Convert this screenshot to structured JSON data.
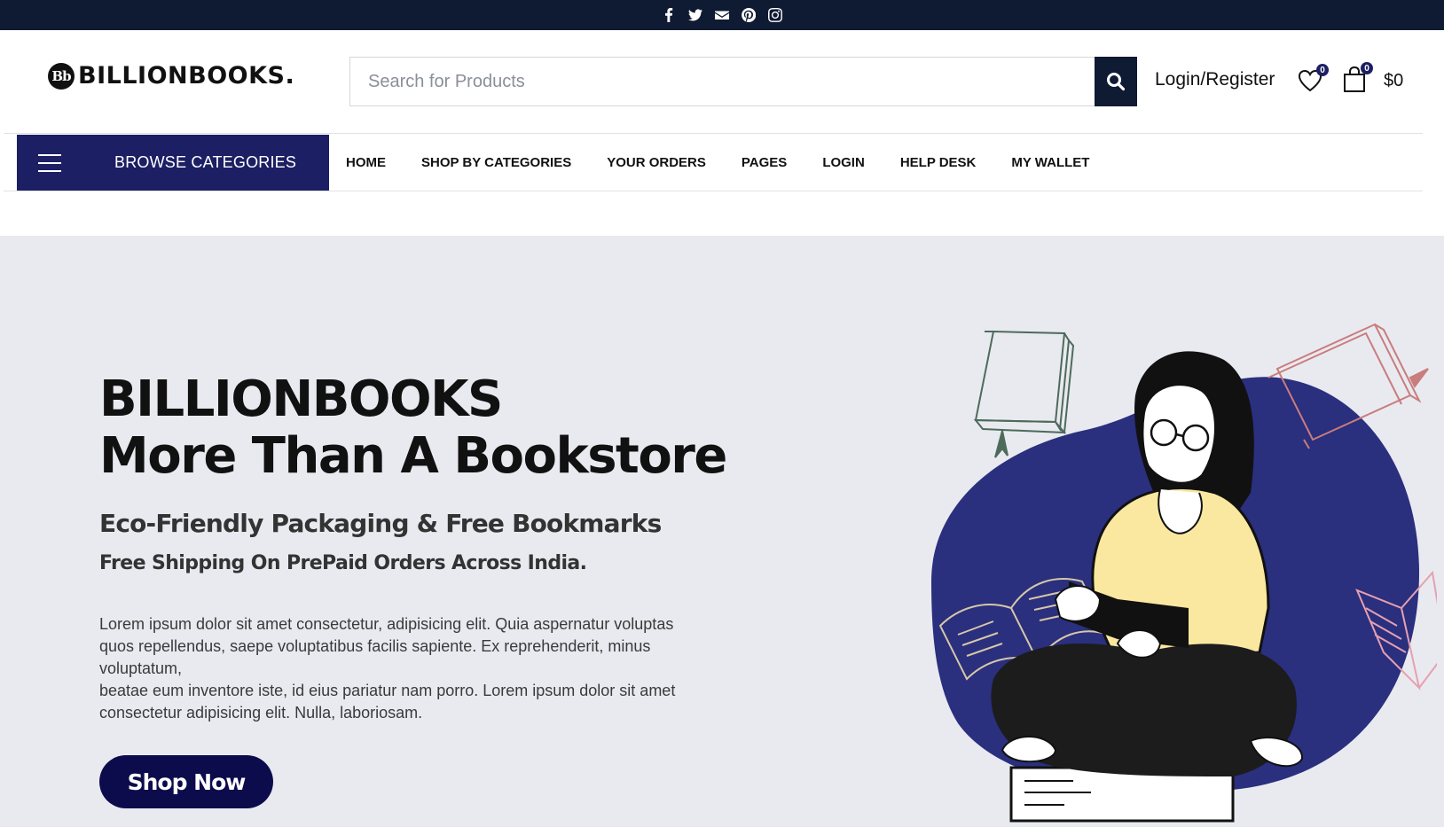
{
  "topbar": {
    "social": [
      {
        "icon": "facebook-icon"
      },
      {
        "icon": "twitter-icon"
      },
      {
        "icon": "email-icon"
      },
      {
        "icon": "pinterest-icon"
      },
      {
        "icon": "instagram-icon"
      }
    ]
  },
  "header": {
    "logo_text": "BILLIONBOOKS.",
    "logo_mark": "Bb",
    "search_placeholder": "Search for Products",
    "login_label": "Login/Register",
    "wishlist_count": "0",
    "cart_count": "0",
    "cart_total": "$0"
  },
  "nav": {
    "browse_label": "BROWSE CATEGORIES",
    "items": [
      "HOME",
      "SHOP BY CATEGORIES",
      "YOUR ORDERS",
      "PAGES",
      "LOGIN",
      "HELP DESK",
      "MY WALLET"
    ]
  },
  "hero": {
    "title_line1": "BILLIONBOOKS",
    "title_line2": "More Than A Bookstore",
    "subtitle": "Eco-Friendly Packaging & Free Bookmarks",
    "subtitle2": "Free Shipping On PrePaid Orders Across India.",
    "paragraph_line1": "Lorem ipsum dolor sit amet consectetur, adipisicing elit. Quia aspernatur voluptas quos repellendus, saepe voluptatibus facilis sapiente. Ex reprehenderit, minus voluptatum,",
    "paragraph_line2": "beatae eum inventore iste, id eius pariatur nam porro. Lorem ipsum dolor sit amet consectetur adipisicing elit. Nulla, laboriosam.",
    "cta_label": "Shop Now"
  },
  "colors": {
    "topbar_bg": "#0f1a33",
    "brand_navy": "#1c1f63",
    "hero_bg": "#e9eaf0",
    "blob": "#2a2f7e",
    "shirt": "#fbe8a0",
    "cta_bg": "#0c0b4c"
  }
}
